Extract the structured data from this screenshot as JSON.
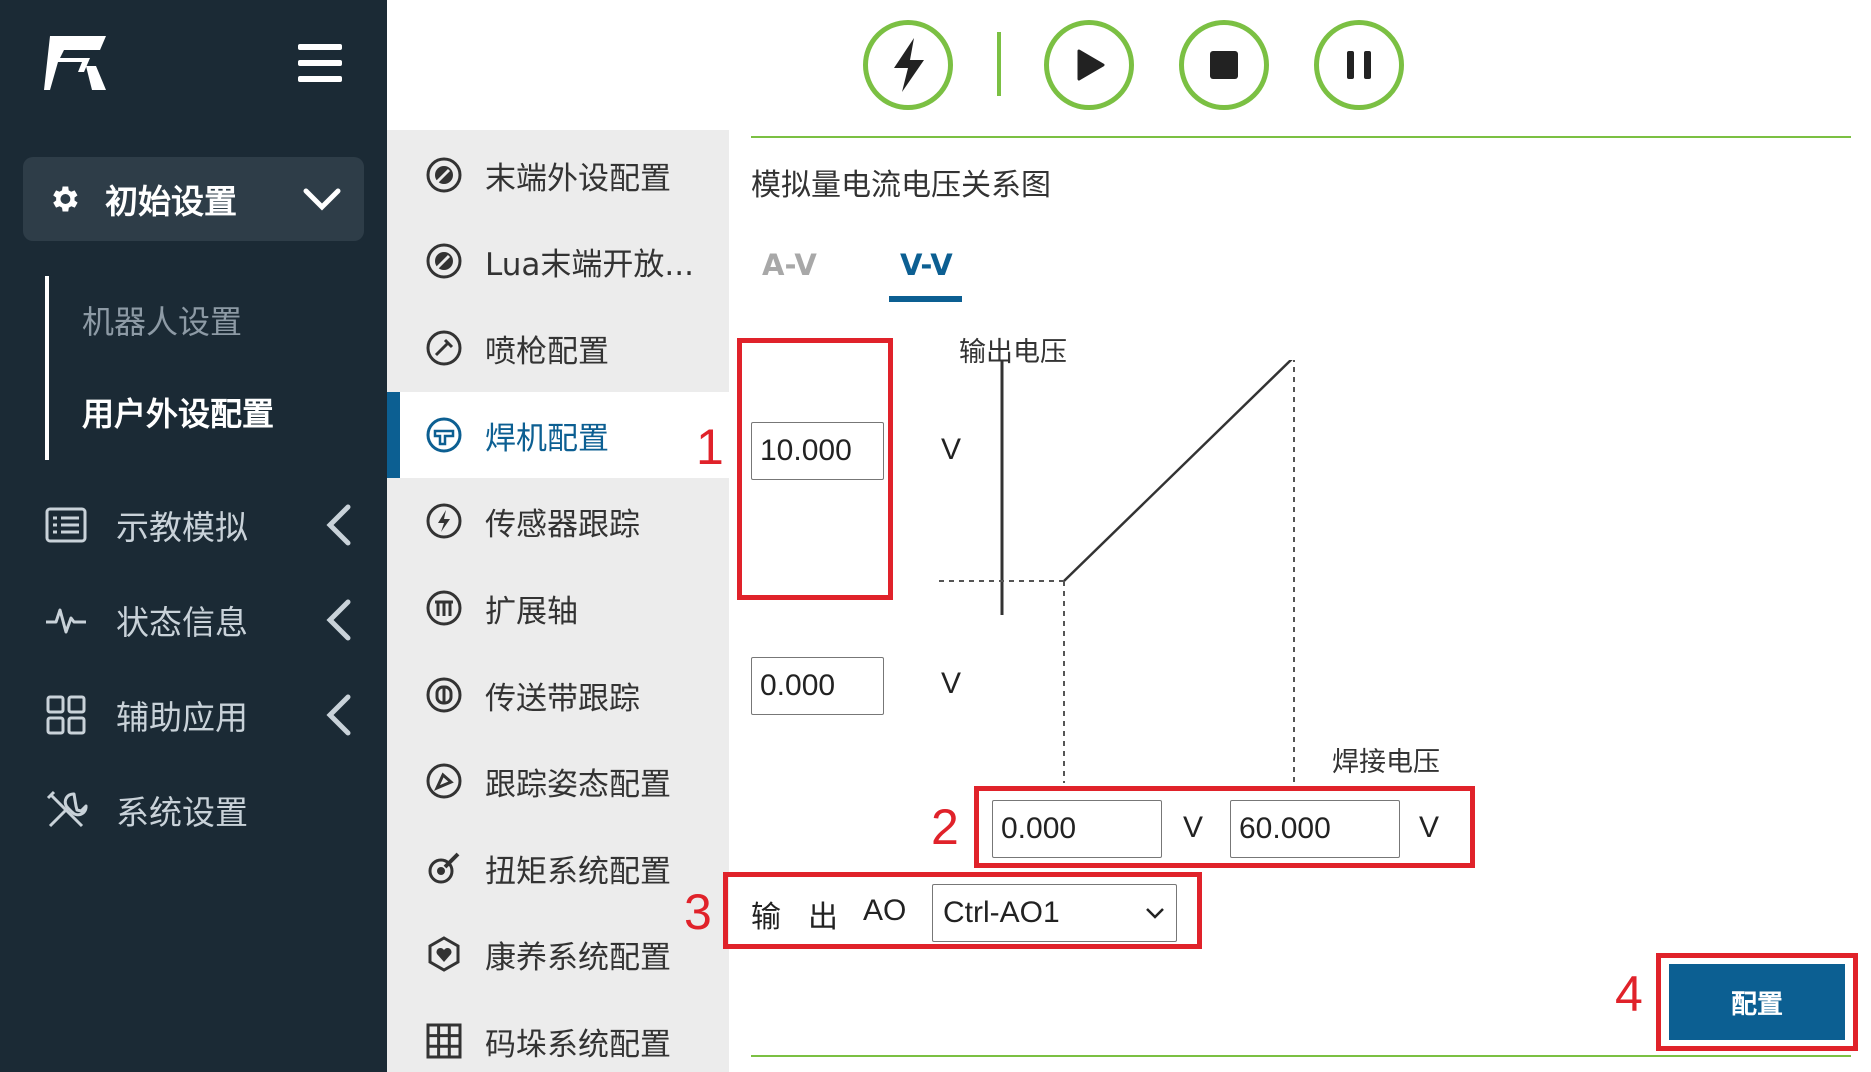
{
  "sidebar": {
    "group_active": {
      "label": "初始设置",
      "icon": "gear-icon"
    },
    "sub_items": [
      {
        "label": "机器人设置",
        "active": false
      },
      {
        "label": "用户外设配置",
        "active": true
      }
    ],
    "nav_items": [
      {
        "label": "示教模拟",
        "icon": "list-icon"
      },
      {
        "label": "状态信息",
        "icon": "pulse-icon"
      },
      {
        "label": "辅助应用",
        "icon": "grid-icon"
      },
      {
        "label": "系统设置",
        "icon": "tools-icon"
      }
    ]
  },
  "toolbar": {
    "buttons": [
      "power-icon",
      "play-icon",
      "stop-icon",
      "pause-icon"
    ]
  },
  "midmenu": {
    "items": [
      {
        "label": "末端外设配置",
        "active": false
      },
      {
        "label": "Lua末端开放...",
        "active": false
      },
      {
        "label": "喷枪配置",
        "active": false
      },
      {
        "label": "焊机配置",
        "active": true
      },
      {
        "label": "传感器跟踪",
        "active": false
      },
      {
        "label": "扩展轴",
        "active": false
      },
      {
        "label": "传送带跟踪",
        "active": false
      },
      {
        "label": "跟踪姿态配置",
        "active": false
      },
      {
        "label": "扭矩系统配置",
        "active": false
      },
      {
        "label": "康养系统配置",
        "active": false
      },
      {
        "label": "码垛系统配置",
        "active": false
      }
    ]
  },
  "content": {
    "title": "模拟量电流电压关系图",
    "tabs": [
      {
        "label": "A-V",
        "active": false
      },
      {
        "label": "V-V",
        "active": true
      }
    ],
    "y_axis_label": "输出电压",
    "x_axis_label": "焊接电压",
    "y_max_value": "10.000",
    "y_min_value": "0.000",
    "x_min_value": "0.000",
    "x_max_value": "60.000",
    "unit": "V",
    "output_label_1": "输",
    "output_label_2": "出",
    "output_label_3": "AO",
    "output_select": "Ctrl-AO1",
    "config_button": "配置",
    "markers": [
      "1",
      "2",
      "3",
      "4"
    ],
    "accent_color": "#0c5f92",
    "highlight_color": "#e0222a",
    "toolbar_color": "#7bc043"
  }
}
